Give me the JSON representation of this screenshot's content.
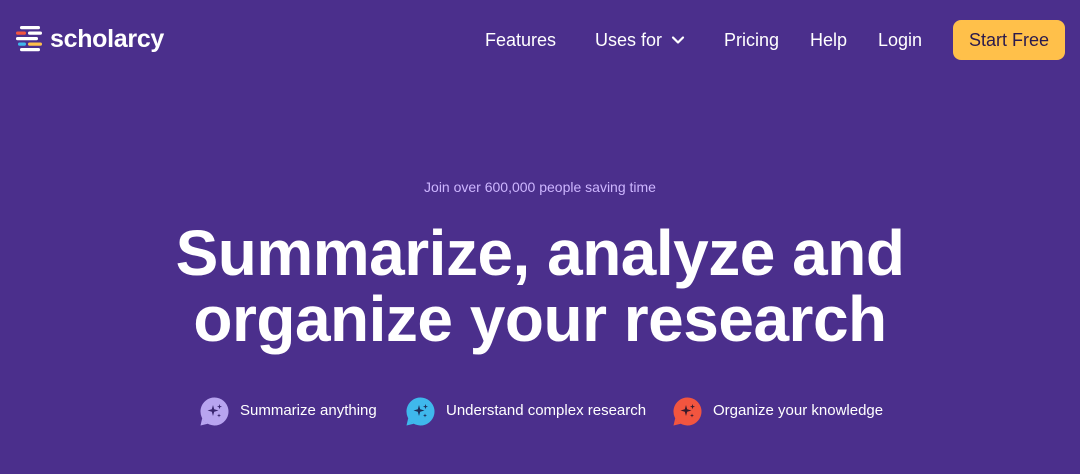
{
  "brand": {
    "name": "scholarcy",
    "colors": {
      "background": "#4b2f8c",
      "cta": "#ffc04a",
      "tagline": "#cdb6ff"
    }
  },
  "nav": {
    "features": "Features",
    "uses_for": "Uses for",
    "pricing": "Pricing",
    "help": "Help",
    "login": "Login",
    "start_free": "Start Free"
  },
  "hero": {
    "tagline": "Join over 600,000 people saving time",
    "headline_line1": "Summarize, analyze and",
    "headline_line2": "organize your research"
  },
  "features": [
    {
      "label": "Summarize anything",
      "icon": "sparkle-bubble-icon",
      "color": "#b8a4f0"
    },
    {
      "label": "Understand complex research",
      "icon": "sparkle-bubble-icon",
      "color": "#3fb8ec"
    },
    {
      "label": "Organize your knowledge",
      "icon": "sparkle-bubble-icon",
      "color": "#f2553f"
    }
  ]
}
